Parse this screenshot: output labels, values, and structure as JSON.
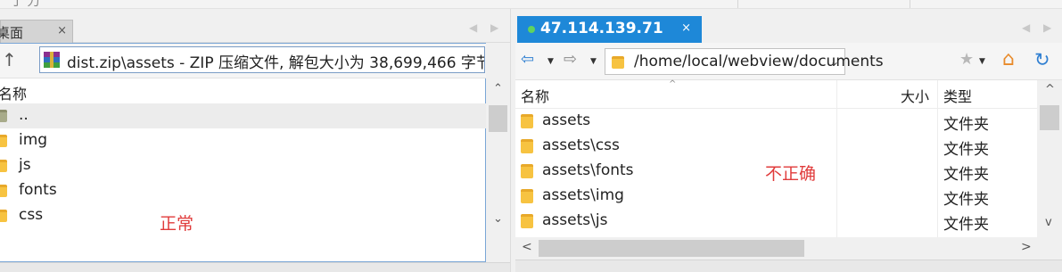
{
  "top": {
    "partial_title": "丁 刀"
  },
  "left_pane": {
    "tab": {
      "label": "桌面",
      "close": "×"
    },
    "nav": {
      "prev": "◀",
      "next": "▶"
    },
    "up_icon": "↑",
    "path": "dist.zip\\assets - ZIP 压缩文件, 解包大小为 38,699,466 字节",
    "column_header": "名称",
    "items": [
      {
        "name": ".."
      },
      {
        "name": "img"
      },
      {
        "name": "js"
      },
      {
        "name": "fonts"
      },
      {
        "name": "css"
      }
    ],
    "annotation": "正常",
    "scroll_up": "⌃",
    "scroll_down": "⌄"
  },
  "right_pane": {
    "tab": {
      "label": "47.114.139.71",
      "close": "×",
      "status_color": "#5fd35f"
    },
    "nav": {
      "prev": "◀",
      "next": "▶"
    },
    "toolbar": {
      "back": "⇦",
      "forward": "⇨",
      "address": "/home/local/webview/documents",
      "dropdown": "⌄",
      "star": "★",
      "home": "⌂",
      "refresh": "↻"
    },
    "columns": {
      "name": "名称",
      "size": "大小",
      "type": "类型"
    },
    "sort_indicator": "^",
    "rows": [
      {
        "name": "assets",
        "type": "文件夹"
      },
      {
        "name": "assets\\css",
        "type": "文件夹"
      },
      {
        "name": "assets\\fonts",
        "type": "文件夹"
      },
      {
        "name": "assets\\img",
        "type": "文件夹"
      },
      {
        "name": "assets\\js",
        "type": "文件夹"
      }
    ],
    "annotation": "不正确",
    "hscroll": {
      "left": "<",
      "right": ">"
    },
    "vscroll": {
      "up": "^",
      "down": "v"
    }
  },
  "colors": {
    "tab_active": "#1e88d8",
    "annotation": "#e03b3b",
    "folder": "#f7c341"
  }
}
